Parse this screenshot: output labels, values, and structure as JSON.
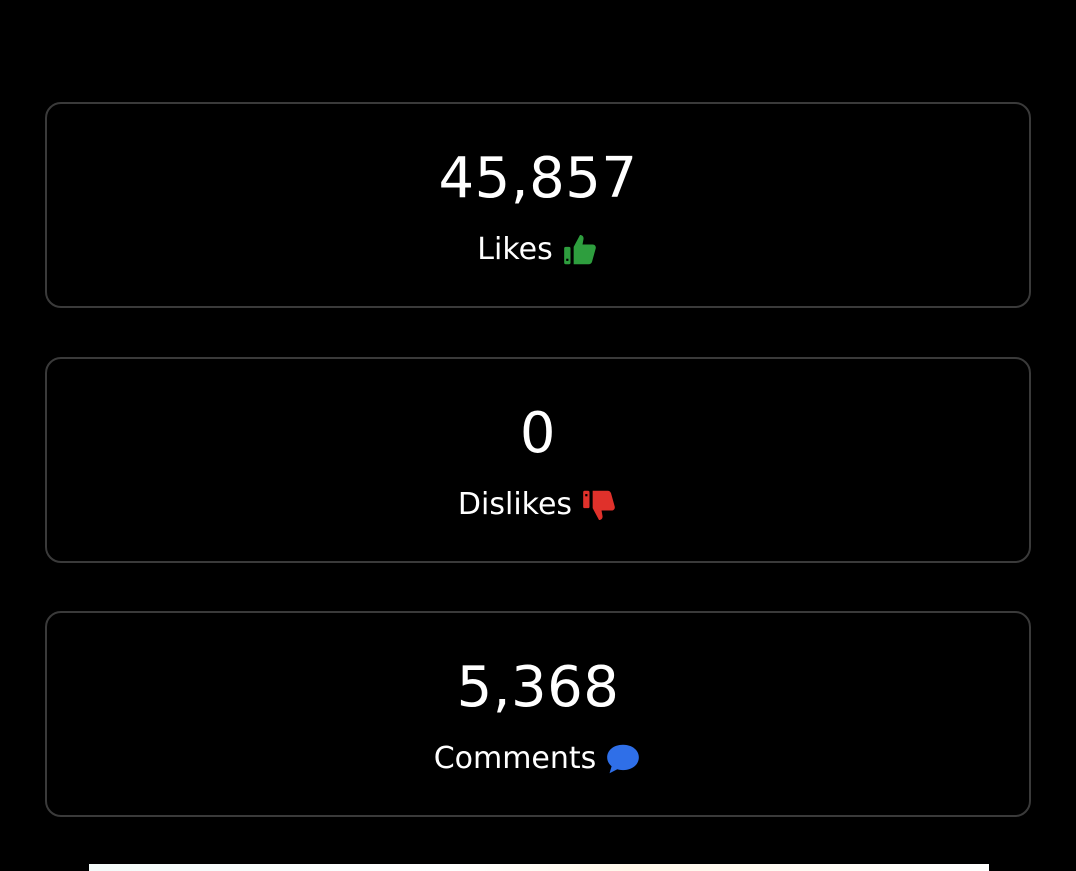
{
  "stats": [
    {
      "value": "45,857",
      "label": "Likes",
      "icon": "thumbs-up-icon",
      "icon_color": "#2e9e3e"
    },
    {
      "value": "0",
      "label": "Dislikes",
      "icon": "thumbs-down-icon",
      "icon_color": "#e0312b"
    },
    {
      "value": "5,368",
      "label": "Comments",
      "icon": "speech-bubble-icon",
      "icon_color": "#2f6fe8"
    }
  ],
  "colors": {
    "background": "#000000",
    "card_border": "#3a3a3a",
    "text": "#ffffff"
  }
}
